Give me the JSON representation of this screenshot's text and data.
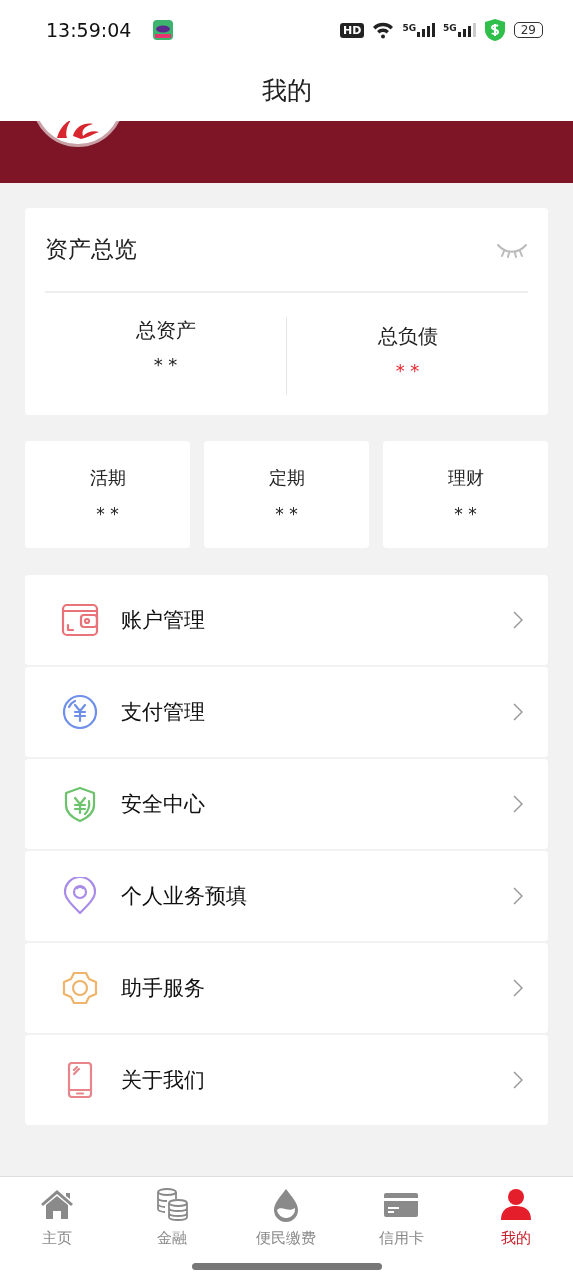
{
  "status_bar": {
    "time": "13:59:04",
    "hd": "HD",
    "networks": [
      "5G",
      "5G"
    ],
    "battery": "29"
  },
  "header": {
    "title": "我的"
  },
  "assets": {
    "title": "资产总览",
    "totals": [
      {
        "label": "总资产",
        "value": "* *",
        "alert": false
      },
      {
        "label": "总负债",
        "value": "* *",
        "alert": true
      }
    ]
  },
  "accounts": [
    {
      "label": "活期",
      "value": "* *"
    },
    {
      "label": "定期",
      "value": "* *"
    },
    {
      "label": "理财",
      "value": "* *"
    }
  ],
  "menu": [
    {
      "kind": "wallet",
      "label": "账户管理",
      "color": "#e8747a"
    },
    {
      "kind": "coin",
      "label": "支付管理",
      "color": "#6f8fe8"
    },
    {
      "kind": "shield",
      "label": "安全中心",
      "color": "#6cc36c"
    },
    {
      "kind": "pin",
      "label": "个人业务预填",
      "color": "#a98be8"
    },
    {
      "kind": "gear",
      "label": "助手服务",
      "color": "#f0b46a"
    },
    {
      "kind": "phone",
      "label": "关于我们",
      "color": "#e8858a"
    }
  ],
  "tabs": [
    {
      "kind": "home",
      "label": "主页",
      "selected": false
    },
    {
      "kind": "coins",
      "label": "金融",
      "selected": false
    },
    {
      "kind": "drop",
      "label": "便民缴费",
      "selected": false
    },
    {
      "kind": "card",
      "label": "信用卡",
      "selected": false
    },
    {
      "kind": "person",
      "label": "我的",
      "selected": true
    }
  ]
}
